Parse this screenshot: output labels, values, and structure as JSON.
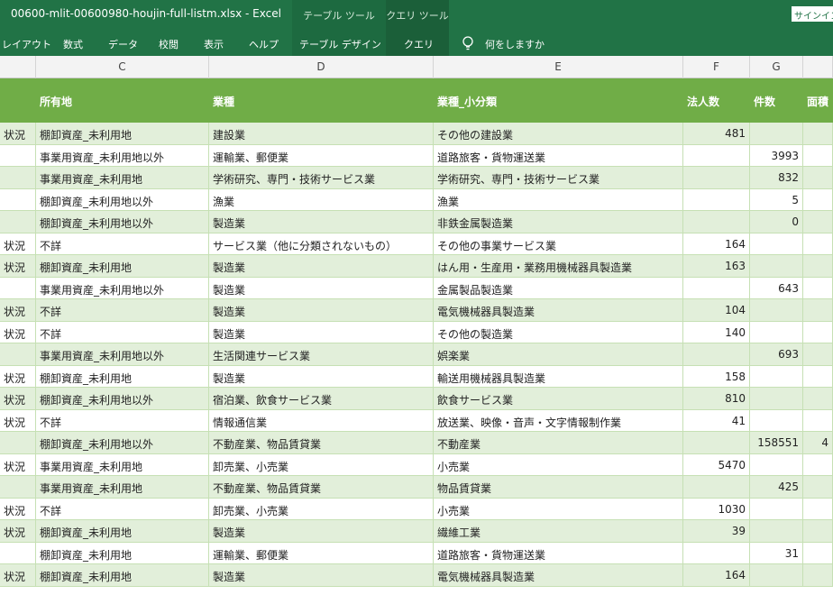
{
  "window": {
    "title": "00600-mlit-00600980-houjin-full-listm.xlsx  -  Excel",
    "context_tab_table": "テーブル ツール",
    "context_tab_query": "クエリ ツール",
    "signin": "サインイン"
  },
  "ribbon": {
    "tabs": [
      "レイアウト",
      "数式",
      "データ",
      "校閲",
      "表示",
      "ヘルプ",
      "テーブル デザイン",
      "クエリ"
    ],
    "tellme": "何をしますか"
  },
  "columns": [
    "C",
    "D",
    "E",
    "F",
    "G"
  ],
  "header": {
    "col_b": "",
    "col_c": "所有地",
    "col_d": "業種",
    "col_e": "業種_小分類",
    "col_f": "法人数",
    "col_g": "件数",
    "col_h": "面積"
  },
  "rows": [
    {
      "b": "状況",
      "c": "棚卸資産_未利用地",
      "d": "建設業",
      "e": "その他の建設業",
      "f": "481",
      "g": "",
      "h": ""
    },
    {
      "b": "",
      "c": "事業用資産_未利用地以外",
      "d": "運輸業、郵便業",
      "e": "道路旅客・貨物運送業",
      "f": "",
      "g": "3993",
      "h": ""
    },
    {
      "b": "",
      "c": "事業用資産_未利用地",
      "d": "学術研究、専門・技術サービス業",
      "e": "学術研究、専門・技術サービス業",
      "f": "",
      "g": "832",
      "h": ""
    },
    {
      "b": "",
      "c": "棚卸資産_未利用地以外",
      "d": "漁業",
      "e": "漁業",
      "f": "",
      "g": "5",
      "h": ""
    },
    {
      "b": "",
      "c": "棚卸資産_未利用地以外",
      "d": "製造業",
      "e": "非鉄金属製造業",
      "f": "",
      "g": "0",
      "h": ""
    },
    {
      "b": "状況",
      "c": "不詳",
      "d": "サービス業（他に分類されないもの）",
      "e": "その他の事業サービス業",
      "f": "164",
      "g": "",
      "h": ""
    },
    {
      "b": "状況",
      "c": "棚卸資産_未利用地",
      "d": "製造業",
      "e": "はん用・生産用・業務用機械器具製造業",
      "f": "163",
      "g": "",
      "h": ""
    },
    {
      "b": "",
      "c": "事業用資産_未利用地以外",
      "d": "製造業",
      "e": "金属製品製造業",
      "f": "",
      "g": "643",
      "h": ""
    },
    {
      "b": "状況",
      "c": "不詳",
      "d": "製造業",
      "e": "電気機械器具製造業",
      "f": "104",
      "g": "",
      "h": ""
    },
    {
      "b": "状況",
      "c": "不詳",
      "d": "製造業",
      "e": "その他の製造業",
      "f": "140",
      "g": "",
      "h": ""
    },
    {
      "b": "",
      "c": "事業用資産_未利用地以外",
      "d": "生活関連サービス業",
      "e": "娯楽業",
      "f": "",
      "g": "693",
      "h": ""
    },
    {
      "b": "状況",
      "c": "棚卸資産_未利用地",
      "d": "製造業",
      "e": "輸送用機械器具製造業",
      "f": "158",
      "g": "",
      "h": ""
    },
    {
      "b": "状況",
      "c": "棚卸資産_未利用地以外",
      "d": "宿泊業、飲食サービス業",
      "e": "飲食サービス業",
      "f": "810",
      "g": "",
      "h": ""
    },
    {
      "b": "状況",
      "c": "不詳",
      "d": "情報通信業",
      "e": "放送業、映像・音声・文字情報制作業",
      "f": "41",
      "g": "",
      "h": ""
    },
    {
      "b": "",
      "c": "棚卸資産_未利用地以外",
      "d": "不動産業、物品賃貸業",
      "e": "不動産業",
      "f": "",
      "g": "158551",
      "h": "4"
    },
    {
      "b": "状況",
      "c": "事業用資産_未利用地",
      "d": "卸売業、小売業",
      "e": "小売業",
      "f": "5470",
      "g": "",
      "h": ""
    },
    {
      "b": "",
      "c": "事業用資産_未利用地",
      "d": "不動産業、物品賃貸業",
      "e": "物品賃貸業",
      "f": "",
      "g": "425",
      "h": ""
    },
    {
      "b": "状況",
      "c": "不詳",
      "d": "卸売業、小売業",
      "e": "小売業",
      "f": "1030",
      "g": "",
      "h": ""
    },
    {
      "b": "状況",
      "c": "棚卸資産_未利用地",
      "d": "製造業",
      "e": "繊維工業",
      "f": "39",
      "g": "",
      "h": ""
    },
    {
      "b": "",
      "c": "棚卸資産_未利用地",
      "d": "運輸業、郵便業",
      "e": "道路旅客・貨物運送業",
      "f": "",
      "g": "31",
      "h": ""
    },
    {
      "b": "状況",
      "c": "棚卸資産_未利用地",
      "d": "製造業",
      "e": "電気機械器具製造業",
      "f": "164",
      "g": "",
      "h": ""
    }
  ],
  "colors": {
    "titlebar": "#217346",
    "header_row": "#70ad47",
    "band_row": "#e2efda"
  }
}
